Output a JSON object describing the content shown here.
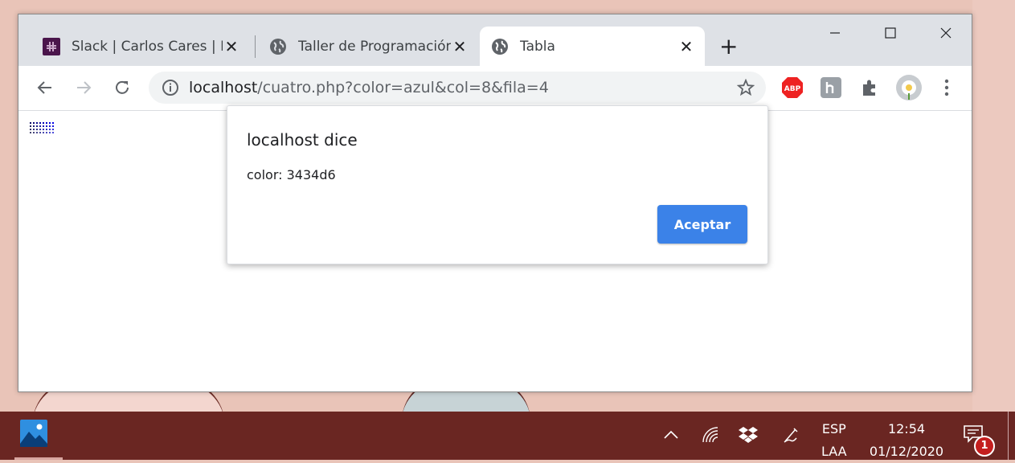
{
  "browser": {
    "tabs": [
      {
        "title": "Slack | Carlos Cares | ICI",
        "favicon": "slack-icon",
        "active": false
      },
      {
        "title": "Taller de Programación",
        "favicon": "globe-icon",
        "active": false
      },
      {
        "title": "Tabla",
        "favicon": "globe-icon",
        "active": true
      }
    ],
    "new_tab_label": "+",
    "address": {
      "host": "localhost",
      "path": "/cuatro.php?color=azul&col=8&fila=4"
    },
    "extensions": [
      "adblock-plus-icon",
      "hypothesis-icon",
      "puzzle-extensions-icon",
      "profile-avatar-icon",
      "menu-kebab-icon"
    ],
    "abp_label": "ABP"
  },
  "page": {
    "color_grid": [
      [
        "#0d0d66",
        "#0b0b7a",
        "#0a0a8c",
        "#0808a3",
        "#0606b8",
        "#0505c8",
        "#0303d8",
        "#0202e8"
      ],
      [
        "#202060",
        "#1f1f78",
        "#1e1e8a",
        "#1d1da0",
        "#1c1cb2",
        "#1a1ac4",
        "#1818d4",
        "#1616e0"
      ],
      [
        "#303066",
        "#313178",
        "#32328a",
        "#33339c",
        "#3434ae",
        "#3434c0",
        "#3434d0",
        "#3434d6"
      ],
      [
        "#464670",
        "#47477e",
        "#48488e",
        "#49499e",
        "#4a4aae",
        "#4b4bbe",
        "#4c4cce",
        "#4d4dda"
      ]
    ]
  },
  "dialog": {
    "title": "localhost dice",
    "message": "color: 3434d6",
    "ok_label": "Aceptar"
  },
  "taskbar": {
    "language_top": "ESP",
    "language_bottom": "LAA",
    "time": "12:54",
    "date": "01/12/2020",
    "notification_count": "1"
  }
}
